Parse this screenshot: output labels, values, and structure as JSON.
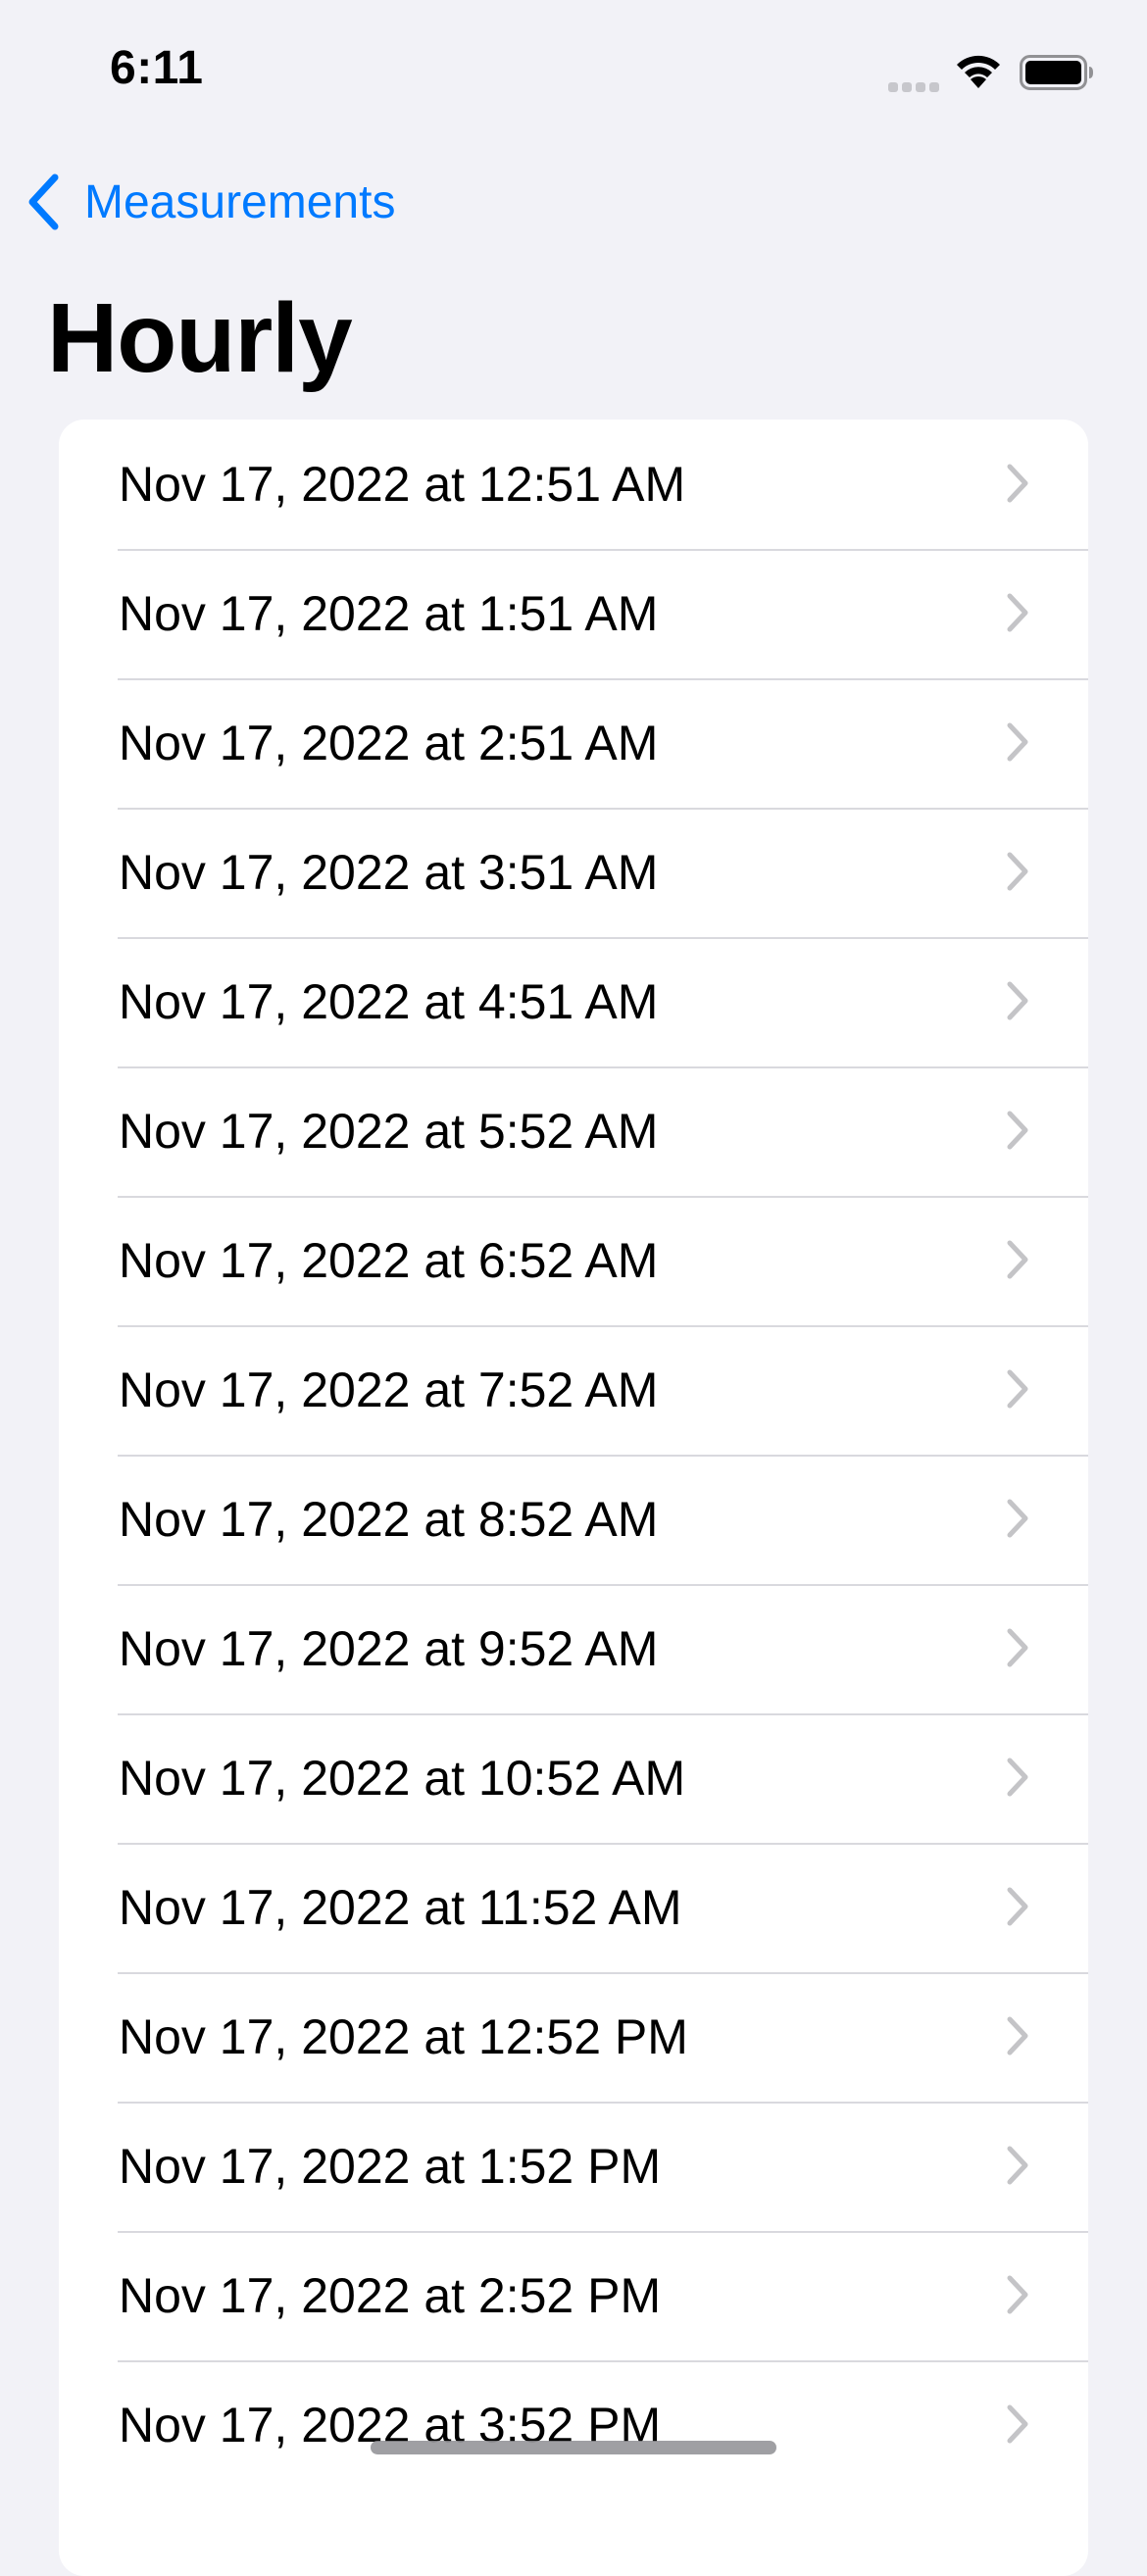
{
  "status_bar": {
    "time": "6:11"
  },
  "nav": {
    "back_label": "Measurements",
    "title": "Hourly"
  },
  "colors": {
    "accent": "#007AFF",
    "background": "#F2F2F7",
    "card": "#FFFFFF",
    "separator": "#D9D9DE",
    "chevron": "#C4C4C7"
  },
  "rows": [
    {
      "label": "Nov 17, 2022 at 12:51 AM"
    },
    {
      "label": "Nov 17, 2022 at 1:51 AM"
    },
    {
      "label": "Nov 17, 2022 at 2:51 AM"
    },
    {
      "label": "Nov 17, 2022 at 3:51 AM"
    },
    {
      "label": "Nov 17, 2022 at 4:51 AM"
    },
    {
      "label": "Nov 17, 2022 at 5:52 AM"
    },
    {
      "label": "Nov 17, 2022 at 6:52 AM"
    },
    {
      "label": "Nov 17, 2022 at 7:52 AM"
    },
    {
      "label": "Nov 17, 2022 at 8:52 AM"
    },
    {
      "label": "Nov 17, 2022 at 9:52 AM"
    },
    {
      "label": "Nov 17, 2022 at 10:52 AM"
    },
    {
      "label": "Nov 17, 2022 at 11:52 AM"
    },
    {
      "label": "Nov 17, 2022 at 12:52 PM"
    },
    {
      "label": "Nov 17, 2022 at 1:52 PM"
    },
    {
      "label": "Nov 17, 2022 at 2:52 PM"
    },
    {
      "label": "Nov 17, 2022 at 3:52 PM"
    }
  ],
  "icons": {
    "signal": "cellular-signal-icon",
    "wifi": "wifi-icon",
    "battery": "battery-icon",
    "back": "chevron-left-icon",
    "disclosure": "chevron-right-icon"
  }
}
